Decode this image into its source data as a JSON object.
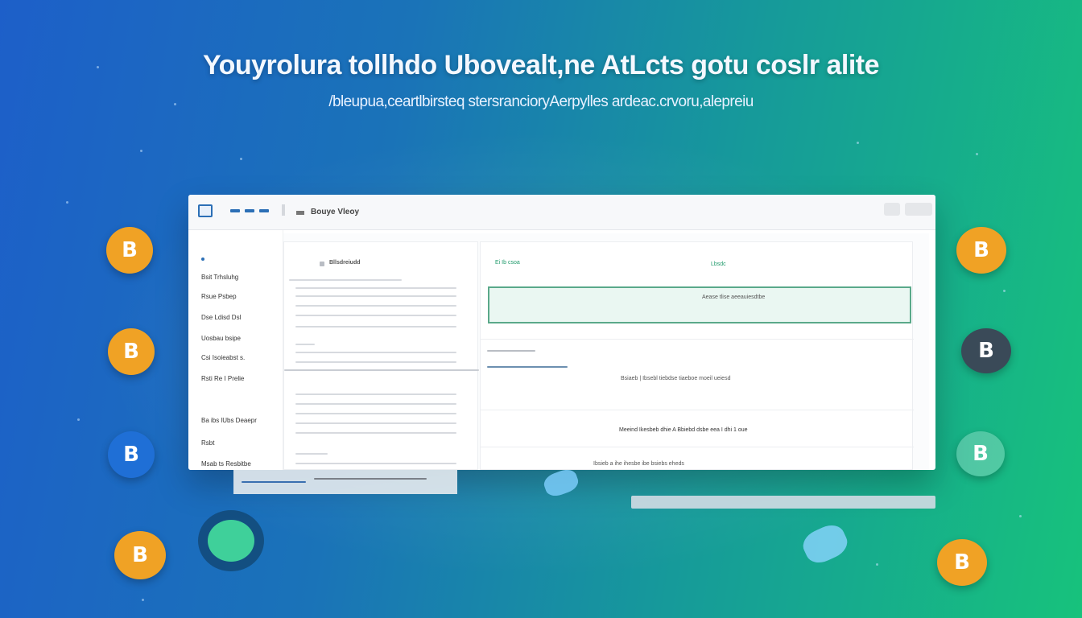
{
  "hero": {
    "headline": "Youyrolura tollhdo Ubovealt,ne AtLcts gotu coslr alite",
    "subheadline": "/bleupua,ceartlbirsteq stersrancioryAerpylles ardeac.crvoru,alepreiu"
  },
  "window": {
    "title": "Bouye Vleoy"
  },
  "sidebar": {
    "items": [
      "Bsit Trhsluhg",
      "Rsue Psbep",
      "Dse Ldisd Dsl",
      "Uosbau bsipe",
      "Csi Isoieabst s.",
      "Rsti Re I Prelie",
      "Ba ibs lUbs Deaepr",
      "Rsbt",
      "Msab ts Resbitbe"
    ]
  },
  "left_column": {
    "heading": "Bllsdreiudd"
  },
  "right_column": {
    "tag_left": "Ei Ib csoa",
    "tag_right": "Lbsdc",
    "highlight_label": "Aease tlise aeeauiesdtbe",
    "row1": "Bsiaeb  |  Ibsebl tiebdse tiaeboe  moeil ueiesd",
    "row2": "Meeind  Ikesbeb  dhie  A Bbiebd dsbe  eea  I dhi 1 oue",
    "row3": "Ibsieb  a ihe  ihesbe  ibe  bsiebs  eheds"
  },
  "coins": {
    "symbol": "B"
  },
  "colors": {
    "gradient_start": "#1d5fc9",
    "gradient_end": "#17c27c",
    "coin_orange": "#f0a225",
    "accent_blue": "#2c6fb6",
    "accent_green": "#5aa98a"
  }
}
